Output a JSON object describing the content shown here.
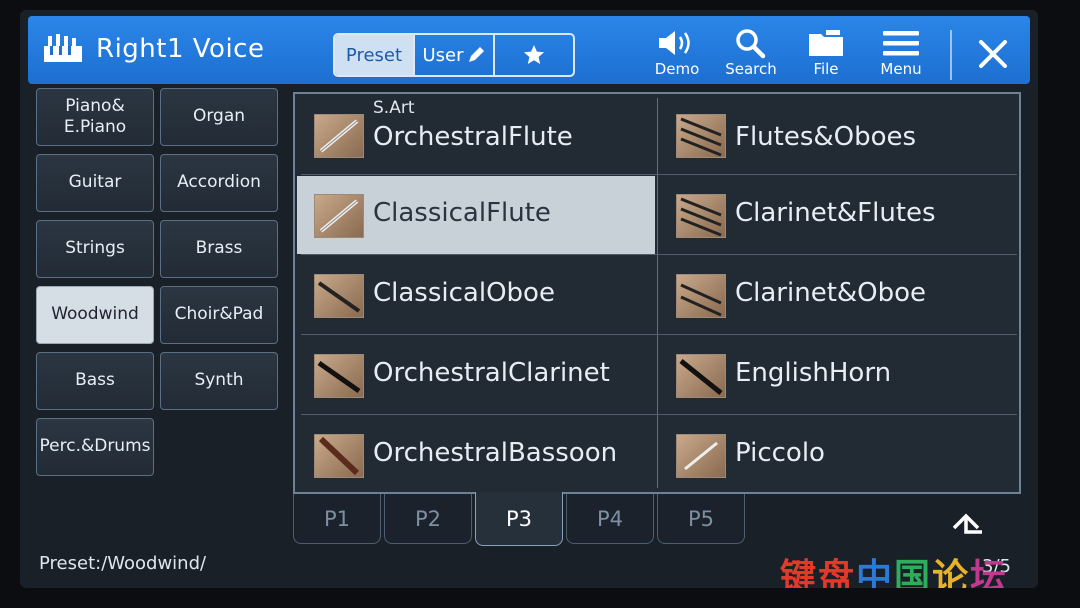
{
  "header": {
    "title": "Right1 Voice",
    "tabs": {
      "preset": "Preset",
      "user": "User"
    },
    "buttons": {
      "demo": "Demo",
      "search": "Search",
      "file": "File",
      "menu": "Menu"
    }
  },
  "categories": [
    "Piano&\nE.Piano",
    "Organ",
    "Guitar",
    "Accordion",
    "Strings",
    "Brass",
    "Woodwind",
    "Choir&Pad",
    "Bass",
    "Synth",
    "Perc.&Drums"
  ],
  "active_category": "Woodwind",
  "voices": [
    {
      "name": "OrchestralFlute",
      "tag": "S.Art"
    },
    {
      "name": "Flutes&Oboes"
    },
    {
      "name": "ClassicalFlute",
      "selected": true
    },
    {
      "name": "Clarinet&Flutes"
    },
    {
      "name": "ClassicalOboe"
    },
    {
      "name": "Clarinet&Oboe"
    },
    {
      "name": "OrchestralClarinet"
    },
    {
      "name": "EnglishHorn"
    },
    {
      "name": "OrchestralBassoon"
    },
    {
      "name": "Piccolo"
    }
  ],
  "pages": [
    "P1",
    "P2",
    "P3",
    "P4",
    "P5"
  ],
  "active_page": "P3",
  "status": {
    "path": "Preset:/Woodwind/",
    "page_count": "3/5"
  },
  "watermark": [
    "键",
    "盘",
    "中",
    "国",
    "论",
    "坛"
  ]
}
